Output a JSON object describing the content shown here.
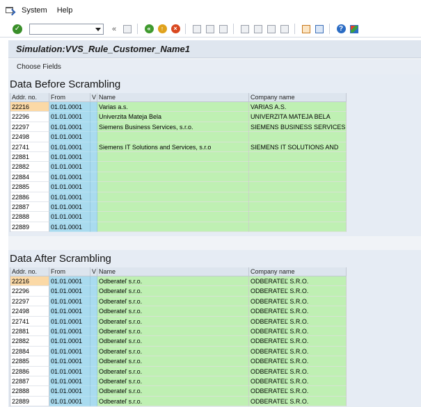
{
  "menu": {
    "items": [
      "System",
      "Help"
    ]
  },
  "toolbar": {
    "command_value": ""
  },
  "title": "Simulation:VVS_Rule_Customer_Name1",
  "app_toolbar": {
    "choose_fields": "Choose Fields"
  },
  "columns": {
    "addr": "Addr. no.",
    "from": "From",
    "v": "V",
    "name": "Name",
    "company": "Company name"
  },
  "before": {
    "title": "Data Before Scrambling",
    "rows": [
      {
        "addr": "22216",
        "from": "01.01.0001",
        "name": "Varias a.s.",
        "company": "VARIAS A.S."
      },
      {
        "addr": "22296",
        "from": "01.01.0001",
        "name": "Univerzita Mateja Bela",
        "company": "UNIVERZITA MATEJA BELA"
      },
      {
        "addr": "22297",
        "from": "01.01.0001",
        "name": "Siemens Business Services, s.r.o.",
        "company": "SIEMENS BUSINESS SERVICES"
      },
      {
        "addr": "22498",
        "from": "01.01.0001",
        "name": "",
        "company": ""
      },
      {
        "addr": "22741",
        "from": "01.01.0001",
        "name": "Siemens IT Solutions and Services, s.r.o",
        "company": "SIEMENS IT SOLUTIONS AND"
      },
      {
        "addr": "22881",
        "from": "01.01.0001",
        "name": "",
        "company": ""
      },
      {
        "addr": "22882",
        "from": "01.01.0001",
        "name": "",
        "company": ""
      },
      {
        "addr": "22884",
        "from": "01.01.0001",
        "name": "",
        "company": ""
      },
      {
        "addr": "22885",
        "from": "01.01.0001",
        "name": "",
        "company": ""
      },
      {
        "addr": "22886",
        "from": "01.01.0001",
        "name": "",
        "company": ""
      },
      {
        "addr": "22887",
        "from": "01.01.0001",
        "name": "",
        "company": ""
      },
      {
        "addr": "22888",
        "from": "01.01.0001",
        "name": "",
        "company": ""
      },
      {
        "addr": "22889",
        "from": "01.01.0001",
        "name": "",
        "company": ""
      }
    ]
  },
  "after": {
    "title": "Data After Scrambling",
    "rows": [
      {
        "addr": "22216",
        "from": "01.01.0001",
        "name": "Odberateľ s.r.o.",
        "company": "ODBERATEĽ S.R.O."
      },
      {
        "addr": "22296",
        "from": "01.01.0001",
        "name": "Odberateľ s.r.o.",
        "company": "ODBERATEĽ S.R.O."
      },
      {
        "addr": "22297",
        "from": "01.01.0001",
        "name": "Odberateľ s.r.o.",
        "company": "ODBERATEĽ S.R.O."
      },
      {
        "addr": "22498",
        "from": "01.01.0001",
        "name": "Odberateľ s.r.o.",
        "company": "ODBERATEĽ S.R.O."
      },
      {
        "addr": "22741",
        "from": "01.01.0001",
        "name": "Odberateľ s.r.o.",
        "company": "ODBERATEĽ S.R.O."
      },
      {
        "addr": "22881",
        "from": "01.01.0001",
        "name": "Odberateľ s.r.o.",
        "company": "ODBERATEĽ S.R.O."
      },
      {
        "addr": "22882",
        "from": "01.01.0001",
        "name": "Odberateľ s.r.o.",
        "company": "ODBERATEĽ S.R.O."
      },
      {
        "addr": "22884",
        "from": "01.01.0001",
        "name": "Odberateľ s.r.o.",
        "company": "ODBERATEĽ S.R.O."
      },
      {
        "addr": "22885",
        "from": "01.01.0001",
        "name": "Odberateľ s.r.o.",
        "company": "ODBERATEĽ S.R.O."
      },
      {
        "addr": "22886",
        "from": "01.01.0001",
        "name": "Odberateľ s.r.o.",
        "company": "ODBERATEĽ S.R.O."
      },
      {
        "addr": "22887",
        "from": "01.01.0001",
        "name": "Odberateľ s.r.o.",
        "company": "ODBERATEĽ S.R.O."
      },
      {
        "addr": "22888",
        "from": "01.01.0001",
        "name": "Odberateľ s.r.o.",
        "company": "ODBERATEĽ S.R.O."
      },
      {
        "addr": "22889",
        "from": "01.01.0001",
        "name": "Odberateľ s.r.o.",
        "company": "ODBERATEĽ S.R.O."
      }
    ]
  },
  "icons": [
    "window-menu-icon",
    "enter-icon",
    "save-icon",
    "back-icon",
    "exit-icon",
    "cancel-icon",
    "print-icon",
    "find-icon",
    "find-next-icon",
    "first-page-icon",
    "previous-page-icon",
    "next-page-icon",
    "last-page-icon",
    "create-session-icon",
    "shortcut-icon",
    "help-icon",
    "customize-layout-icon"
  ],
  "colors": {
    "key_column": "#ffffff",
    "selected_key": "#fbd9a6",
    "date_column": "#a9dbef",
    "data_column": "#bff0b3",
    "header": "#dde5ee",
    "title_bar": "#dfe6ef"
  }
}
